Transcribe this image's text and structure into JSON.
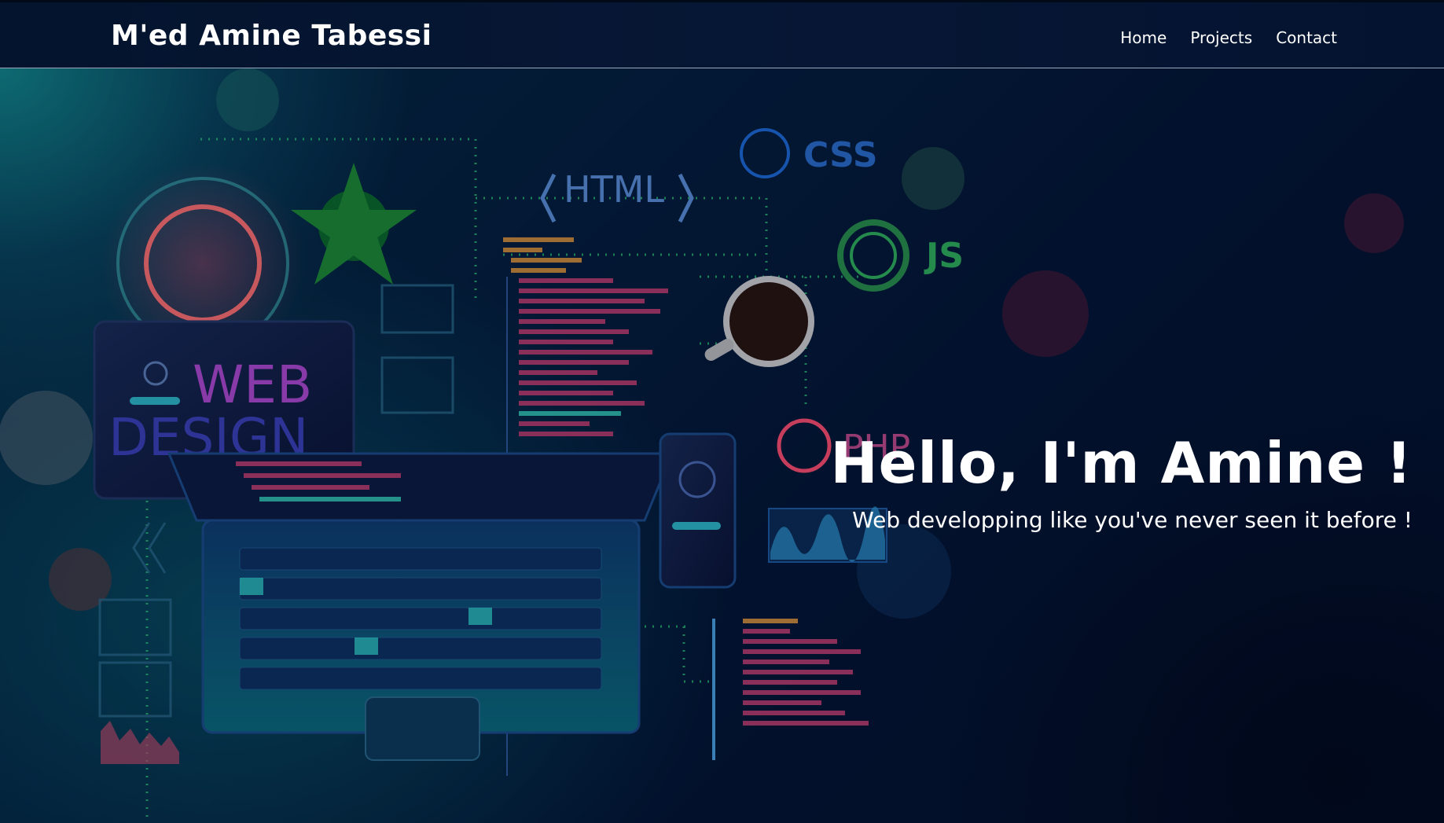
{
  "navbar": {
    "brand": "M'ed Amine Tabessi",
    "links": [
      "Home",
      "Projects",
      "Contact"
    ]
  },
  "hero": {
    "title": "Hello, I'm Amine !",
    "subtitle": "Web developping like you've never seen it before !",
    "illustration_labels": {
      "html": "HTML",
      "css": "CSS",
      "js": "JS",
      "php": "PHP",
      "web": "WEB",
      "design": "DESIGN"
    }
  },
  "colors": {
    "nav_background": "#04142e",
    "hero_teal": "#0a4f66",
    "hero_dark": "#030f28",
    "text": "#ffffff"
  }
}
